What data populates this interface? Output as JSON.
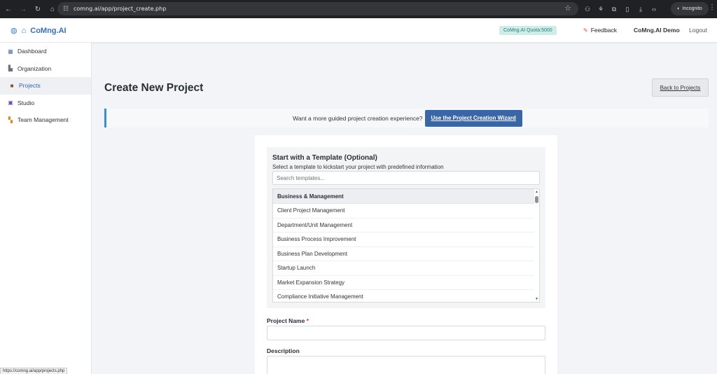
{
  "browser": {
    "url": "comng.ai/app/project_create.php",
    "incognito_label": "Incognito",
    "status_url": "https://comng.ai/app/projects.php"
  },
  "header": {
    "brand": "CoMng.AI",
    "quota": "CoMng.AI Quota:5000",
    "feedback": "Feedback",
    "user": "CoMng.AI Demo",
    "logout": "Logout"
  },
  "sidebar": {
    "items": [
      {
        "label": "Dashboard",
        "icon": "dashboard-icon"
      },
      {
        "label": "Organization",
        "icon": "organization-icon"
      },
      {
        "label": "Projects",
        "icon": "briefcase-icon",
        "active": true
      },
      {
        "label": "Studio",
        "icon": "studio-icon"
      },
      {
        "label": "Team Management",
        "icon": "team-icon"
      }
    ]
  },
  "main": {
    "title": "Create New Project",
    "back_button": "Back to Projects",
    "wizard_text": "Want a more guided project creation experience?",
    "wizard_button": "Use the Project Creation Wizard"
  },
  "template": {
    "title": "Start with a Template (Optional)",
    "subtitle": "Select a template to kickstart your project with predefined information",
    "search_placeholder": "Search templates...",
    "group": "Business & Management",
    "items": [
      "Client Project Management",
      "Department/Unit Management",
      "Business Process Improvement",
      "Business Plan Development",
      "Startup Launch",
      "Market Expansion Strategy",
      "Compliance Initiative Management"
    ]
  },
  "form": {
    "project_name_label": "Project Name",
    "required_mark": "*",
    "description_label": "Description"
  },
  "colors": {
    "accent": "#3b66a6",
    "wizard_border": "#3c8bd6",
    "quota_bg": "#cfece9"
  }
}
